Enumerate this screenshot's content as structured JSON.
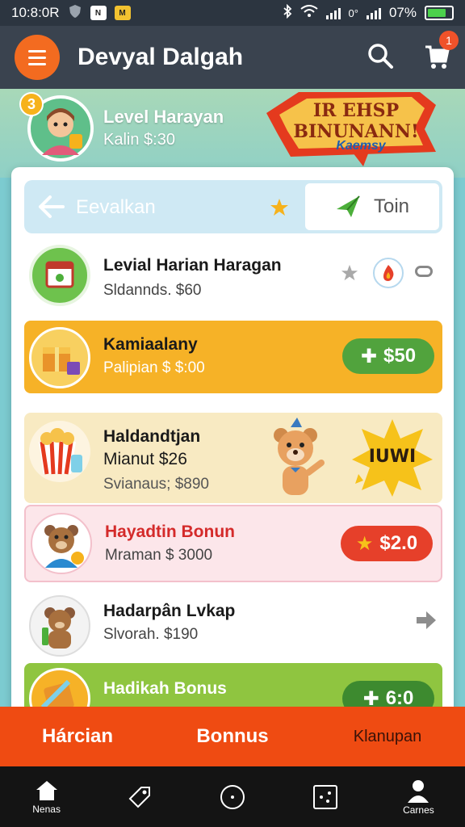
{
  "status_bar": {
    "time": "10:8:0R",
    "battery_text": "07%"
  },
  "app_bar": {
    "title": "Devyal Dalgah",
    "cart_count": "1"
  },
  "hero": {
    "level_number": "3",
    "title": "Level Harayan",
    "subtitle": "Kalin $:30",
    "promo_line1": "IR EHSP",
    "promo_line2": "BINUNANN!",
    "promo_tag": "Kaemsy"
  },
  "search": {
    "label": "Eevalkan",
    "join_label": "Toin"
  },
  "rows": [
    {
      "title": "Levial Harian Haragan",
      "subtitle": "Sldannds. $60"
    },
    {
      "title": "Kamiaalany",
      "subtitle": "Palipian $ $:00",
      "price": "$50"
    },
    {
      "title": "Haldandtjan",
      "subtitle": "Mianut $26",
      "subtitle2": "Svianaus; $890",
      "burst_text": "IUWI"
    },
    {
      "title": "Hayadtin Bonun",
      "subtitle": "Mraman $ 3000",
      "price": "$2.0"
    },
    {
      "title": "Hadarpân Lvkap",
      "subtitle": "Slvorah. $190"
    },
    {
      "title": "Hadikah Bonus",
      "price": "6:0"
    }
  ],
  "tabs": [
    "Hárcian",
    "Bonnus",
    "Klanupan"
  ],
  "nav": [
    {
      "label": "Nenas",
      "icon": "home-icon"
    },
    {
      "label": "",
      "icon": "tag-icon"
    },
    {
      "label": "",
      "icon": "circle-icon"
    },
    {
      "label": "",
      "icon": "dice-icon"
    },
    {
      "label": "Carnes",
      "icon": "user-icon"
    }
  ],
  "colors": {
    "orange_accent": "#ef4b12",
    "appbar": "#3a434f",
    "green_pill": "#51a33d",
    "red_pill": "#e6402a"
  }
}
